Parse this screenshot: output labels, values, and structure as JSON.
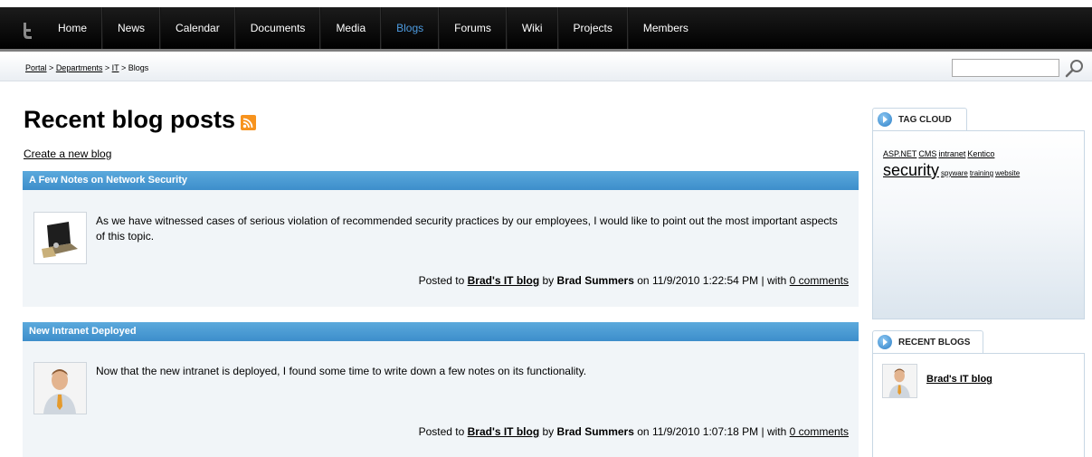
{
  "nav": {
    "logo_icon": "kentico-logo-icon",
    "items": [
      "Home",
      "News",
      "Calendar",
      "Documents",
      "Media",
      "Blogs",
      "Forums",
      "Wiki",
      "Projects",
      "Members"
    ],
    "active": "Blogs",
    "active_color": "#4d9be0"
  },
  "breadcrumb": {
    "items": [
      "Portal",
      "Departments",
      "IT"
    ],
    "current": "Blogs",
    "separator": ">"
  },
  "search": {
    "value": "",
    "button_icon": "magnifier-icon"
  },
  "main": {
    "title": "Recent blog posts",
    "rss_icon": "rss-icon",
    "create_link": "Create a new blog",
    "posts": [
      {
        "title": "A Few Notes on Network Security",
        "thumb_icon": "laptop-lock-image",
        "text": "As we have witnessed cases of serious violation of recommended security practices by our employees, I would like to point out the most important aspects of this topic.",
        "posted_to_label": "Posted to",
        "blog": "Brad's IT blog",
        "by_label": "by",
        "author": "Brad Summers",
        "on_label": "on",
        "date": "11/9/2010 1:22:54 PM",
        "with_label": "| with",
        "comments": "0 comments"
      },
      {
        "title": "New Intranet Deployed",
        "thumb_icon": "person-avatar-image",
        "text": "Now that the new intranet is deployed, I found some time to write down a few notes on its functionality.",
        "posted_to_label": "Posted to",
        "blog": "Brad's IT blog",
        "by_label": "by",
        "author": "Brad Summers",
        "on_label": "on",
        "date": "11/9/2010 1:07:18 PM",
        "with_label": "| with",
        "comments": "0 comments"
      }
    ]
  },
  "sidebar": {
    "tag_cloud": {
      "title": "TAG CLOUD",
      "tags": [
        {
          "label": "ASP.NET",
          "weight": 2
        },
        {
          "label": "CMS",
          "weight": 2
        },
        {
          "label": "intranet",
          "weight": 2
        },
        {
          "label": "Kentico",
          "weight": 2
        },
        {
          "label": "security",
          "weight": 5
        },
        {
          "label": "spyware",
          "weight": 1
        },
        {
          "label": "training",
          "weight": 1
        },
        {
          "label": "website",
          "weight": 1
        }
      ]
    },
    "recent_blogs": {
      "title": "RECENT BLOGS",
      "items": [
        {
          "label": "Brad's IT blog"
        }
      ]
    }
  },
  "colors": {
    "header_blue": "#3d8ecb",
    "post_bg": "#f1f5f8",
    "rss_orange": "#f7931e"
  }
}
